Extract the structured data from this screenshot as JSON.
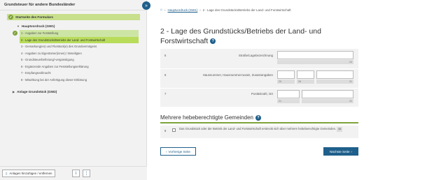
{
  "sidebar": {
    "title": "Grundsteuer für andere Bundesländer",
    "start": "Startseite des Formulars",
    "hauptvordruck": "Hauptvordruck (GW1)",
    "items": [
      {
        "label": "1 - Angaben zur Feststellung",
        "state": "done"
      },
      {
        "label": "2 - Lage des Grundstücks/Betriebs der Land- und Forstwirtschaft",
        "state": "active"
      },
      {
        "label": "3 - Gemarkung(en) und Flurstück(e) des Grundvermögens",
        "state": "open"
      },
      {
        "label": "4 - Angaben zu Eigentümer(innen) / Beteiligten",
        "state": "open"
      },
      {
        "label": "5 - Grundsteuerbefreiung/-vergünstigung",
        "state": "open"
      },
      {
        "label": "6 - Ergänzende Angaben zur Feststellungserklärung",
        "state": "open"
      },
      {
        "label": "7 - Empfangsvollmacht",
        "state": "open"
      },
      {
        "label": "8 - Mitwirkung bei der Anfertigung dieser Erklärung",
        "state": "open"
      }
    ],
    "anlage": "Anlage Grundstück (GW2)",
    "add_button": "Anlagen hinzufügen / entfernen",
    "toggle_icon": "»"
  },
  "breadcrumb": {
    "home_icon": "home-icon",
    "link": "Hauptvordruck (GW1)",
    "current": "2 - Lage des Grundstücks/Betriebs der Land- und Forstwirtschaft"
  },
  "page_title": "2 - Lage des Grundstücks/Betriebs der Land- und Forstwirtschaft",
  "rows": [
    {
      "num": "5",
      "label": "Straße/Lagebezeichnung",
      "counters": [
        "24"
      ]
    },
    {
      "num": "6",
      "label": "Hausnummer, Hausnummerzusatz, Zusatzangaben",
      "counters": [
        "25",
        "26",
        "31"
      ]
    },
    {
      "num": "7",
      "label": "Postleitzahl, Ort",
      "counters": [
        "21",
        "22"
      ]
    }
  ],
  "section2": {
    "title": "Mehrere hebeberechtigte Gemeinden",
    "row_num": "8",
    "text": "Das Grundstück oder der Betrieb der Land- und Forstwirtschaft erstreckt sich über mehrere hebeberechtigte Gemeinden.",
    "badge": "88"
  },
  "nav": {
    "prev": "Vorherige Seite",
    "next": "Nächste Seite"
  },
  "colors": {
    "accent": "#1f5f8b",
    "green": "#7ea33a",
    "active": "#b8dc5a"
  }
}
